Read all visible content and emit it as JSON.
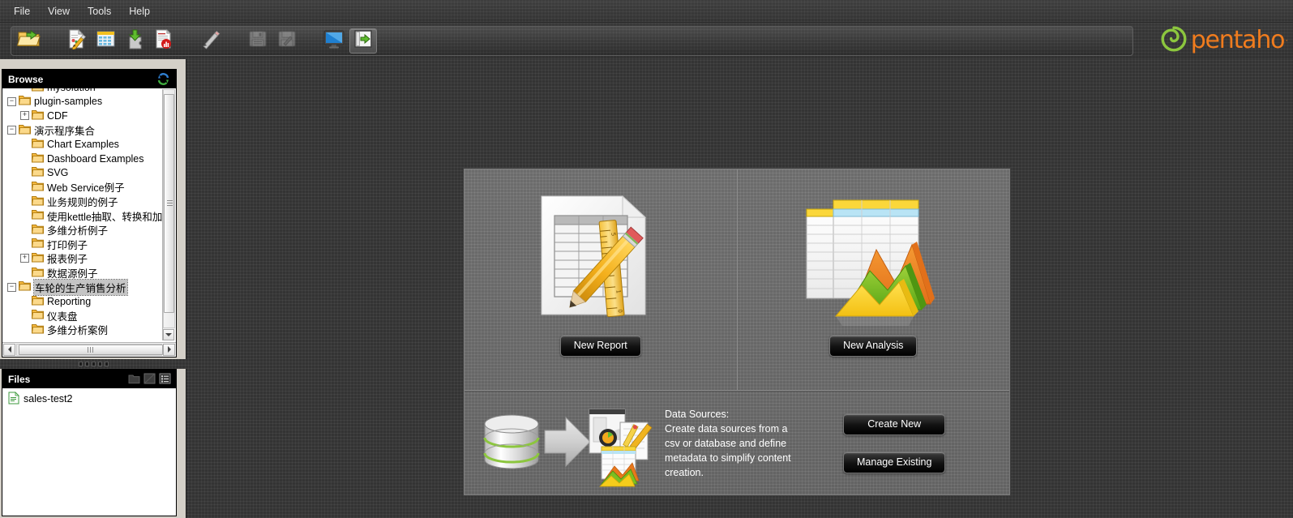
{
  "menubar": {
    "items": [
      {
        "label": "File",
        "name": "menu-file"
      },
      {
        "label": "View",
        "name": "menu-view"
      },
      {
        "label": "Tools",
        "name": "menu-tools"
      },
      {
        "label": "Help",
        "name": "menu-help"
      }
    ]
  },
  "toolbar": {
    "buttons": [
      {
        "icon": "open-folder-icon",
        "name": "open-button",
        "state": "enabled"
      },
      {
        "icon": "new-report-icon",
        "name": "new-report-button",
        "state": "enabled"
      },
      {
        "icon": "new-analysis-grid-icon",
        "name": "new-analysis-button",
        "state": "enabled"
      },
      {
        "icon": "new-datasource-icon",
        "name": "new-datasource-button",
        "state": "enabled"
      },
      {
        "icon": "print-report-icon",
        "name": "print-button",
        "state": "enabled"
      },
      {
        "icon": "pencil-edit-icon",
        "name": "edit-button",
        "state": "enabled"
      },
      {
        "icon": "save-icon",
        "name": "save-button",
        "state": "disabled"
      },
      {
        "icon": "save-as-icon",
        "name": "save-as-button",
        "state": "disabled"
      },
      {
        "icon": "monitor-icon",
        "name": "view-mode-button",
        "state": "enabled"
      },
      {
        "icon": "show-browser-icon",
        "name": "toggle-browser-button",
        "state": "active"
      }
    ]
  },
  "logo": {
    "word": "pentaho",
    "registered": "·",
    "icon": "pentaho-spiral-icon",
    "spiral_color": "#8cc63e",
    "word_color": "#f07c1e"
  },
  "browse": {
    "title": "Browse",
    "refresh_icon": "refresh-icon",
    "tree": [
      {
        "label": "mysolution",
        "depth": 1,
        "toggle": "none",
        "selected": false,
        "clipped": true
      },
      {
        "label": "plugin-samples",
        "depth": 0,
        "toggle": "minus",
        "selected": false
      },
      {
        "label": "CDF",
        "depth": 1,
        "toggle": "plus",
        "selected": false
      },
      {
        "label": "演示程序集合",
        "depth": 0,
        "toggle": "minus",
        "selected": false
      },
      {
        "label": "Chart Examples",
        "depth": 1,
        "toggle": "none",
        "selected": false
      },
      {
        "label": "Dashboard Examples",
        "depth": 1,
        "toggle": "none",
        "selected": false
      },
      {
        "label": "SVG",
        "depth": 1,
        "toggle": "none",
        "selected": false
      },
      {
        "label": "Web Service例子",
        "depth": 1,
        "toggle": "none",
        "selected": false
      },
      {
        "label": "业务规则的例子",
        "depth": 1,
        "toggle": "none",
        "selected": false
      },
      {
        "label": "使用kettle抽取、转换和加",
        "depth": 1,
        "toggle": "none",
        "selected": false
      },
      {
        "label": "多维分析例子",
        "depth": 1,
        "toggle": "none",
        "selected": false
      },
      {
        "label": "打印例子",
        "depth": 1,
        "toggle": "none",
        "selected": false
      },
      {
        "label": "报表例子",
        "depth": 1,
        "toggle": "plus",
        "selected": false
      },
      {
        "label": "数据源例子",
        "depth": 1,
        "toggle": "none",
        "selected": false
      },
      {
        "label": "车轮的生产销售分析",
        "depth": 0,
        "toggle": "minus",
        "selected": true
      },
      {
        "label": "Reporting",
        "depth": 1,
        "toggle": "none",
        "selected": false
      },
      {
        "label": "仪表盘",
        "depth": 1,
        "toggle": "none",
        "selected": false
      },
      {
        "label": "多维分析案例",
        "depth": 1,
        "toggle": "none",
        "selected": false
      }
    ]
  },
  "files": {
    "title": "Files",
    "header_icons": [
      {
        "icon": "folder-view-icon",
        "name": "files-folder-view-button"
      },
      {
        "icon": "detail-view-icon",
        "name": "files-detail-view-button"
      },
      {
        "icon": "list-view-icon",
        "name": "files-list-view-button"
      }
    ],
    "items": [
      {
        "label": "sales-test2",
        "icon": "document-icon"
      }
    ]
  },
  "launch": {
    "new_report": {
      "button_label": "New Report",
      "art_icon": "report-document-ruler-pencil-icon"
    },
    "new_analysis": {
      "button_label": "New Analysis",
      "art_icon": "analysis-grid-chart-icon"
    },
    "data_sources": {
      "art_icon": "database-arrow-documents-icon",
      "heading": "Data Sources:",
      "description_lines": [
        "Create data sources from a",
        "csv or database and define",
        "metadata to simplify content",
        "creation."
      ],
      "create_label": "Create New",
      "manage_label": "Manage Existing"
    }
  },
  "theme": {
    "background": "#3a3a3a",
    "panel_background": "#6f6f6f",
    "header_background": "#000000",
    "accent_orange": "#f07c1e",
    "accent_green": "#8cc63e",
    "folder_yellow": "#f5b93f",
    "selection_gray": "#c5c5c5"
  }
}
